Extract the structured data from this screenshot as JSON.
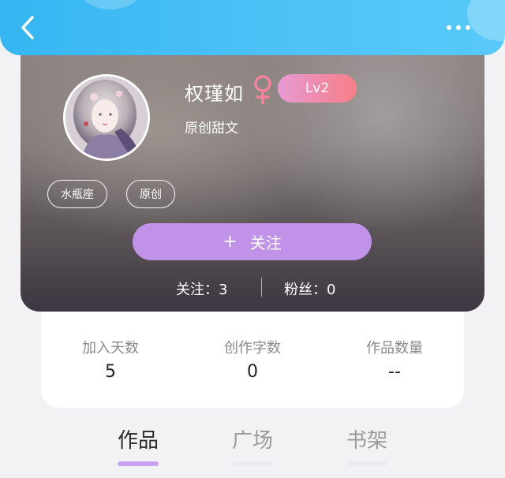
{
  "nav": {
    "back_icon": "chevron-left-icon",
    "more_icon": "more-horizontal-icon"
  },
  "profile": {
    "username": "权瑾如",
    "gender_icon": "female-icon",
    "level": "Lv2",
    "bio": "原创甜文",
    "tags": [
      "水瓶座",
      "原创"
    ],
    "follow_button": {
      "plus": "+",
      "label": "关注"
    },
    "following_text": "关注：3",
    "fans_text": "粉丝：0"
  },
  "stats": [
    {
      "label": "加入天数",
      "value": "5"
    },
    {
      "label": "创作字数",
      "value": "0"
    },
    {
      "label": "作品数量",
      "value": "--"
    }
  ],
  "tabs": [
    {
      "label": "作品",
      "active": true
    },
    {
      "label": "广场",
      "active": false
    },
    {
      "label": "书架",
      "active": false
    }
  ],
  "colors": {
    "header_blue": "#4fc3f7",
    "follow_purple": "#c093e8",
    "level_pink": "#f08aa8",
    "gender_pink": "#f3839c",
    "tab_underline": "#c9a3ee"
  }
}
